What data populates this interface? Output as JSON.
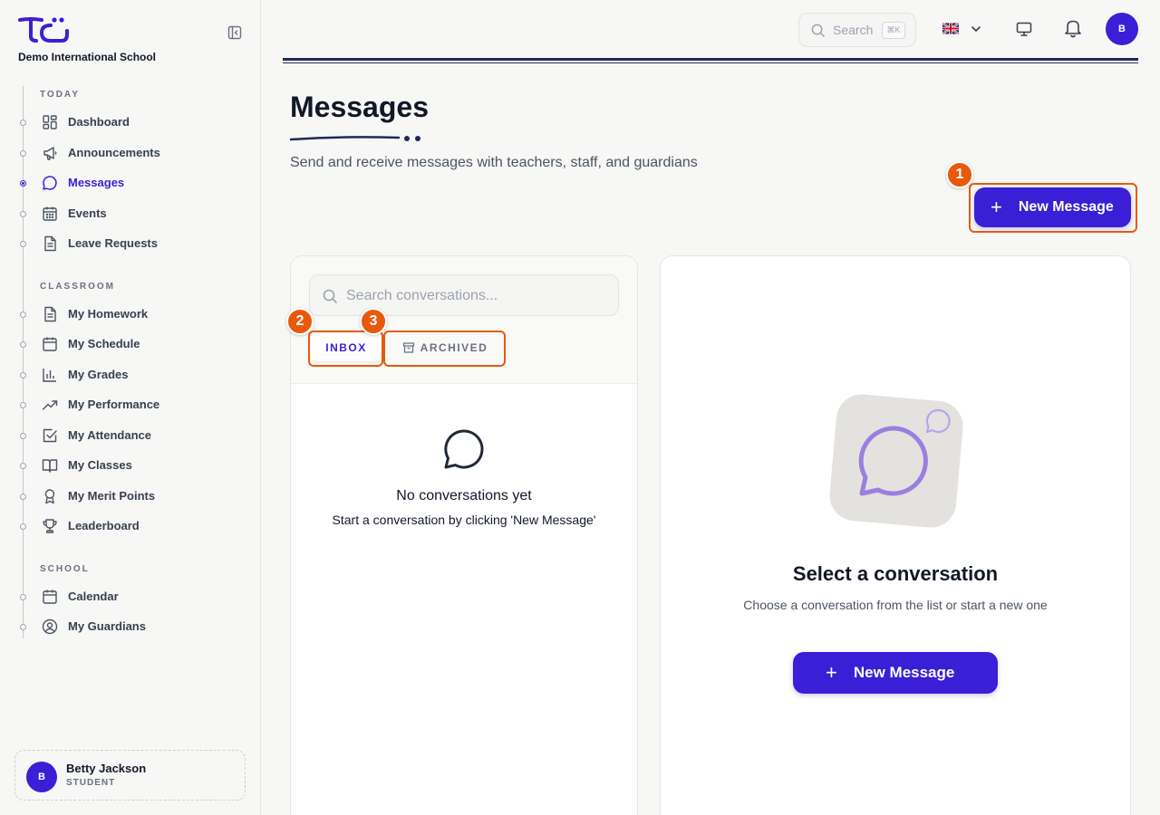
{
  "app": {
    "school_name": "Demo International School"
  },
  "sidebar": {
    "sections": [
      {
        "title": "TODAY",
        "items": [
          {
            "label": "Dashboard",
            "icon": "dashboard-icon"
          },
          {
            "label": "Announcements",
            "icon": "megaphone-icon"
          },
          {
            "label": "Messages",
            "icon": "chat-bubble-icon",
            "active": true
          },
          {
            "label": "Events",
            "icon": "calendar-grid-icon"
          },
          {
            "label": "Leave Requests",
            "icon": "document-icon"
          }
        ]
      },
      {
        "title": "CLASSROOM",
        "items": [
          {
            "label": "My Homework",
            "icon": "document-icon"
          },
          {
            "label": "My Schedule",
            "icon": "calendar-icon"
          },
          {
            "label": "My Grades",
            "icon": "bar-chart-icon"
          },
          {
            "label": "My Performance",
            "icon": "trending-up-icon"
          },
          {
            "label": "My Attendance",
            "icon": "checkbox-icon"
          },
          {
            "label": "My Classes",
            "icon": "book-icon"
          },
          {
            "label": "My Merit Points",
            "icon": "award-icon"
          },
          {
            "label": "Leaderboard",
            "icon": "trophy-icon"
          }
        ]
      },
      {
        "title": "SCHOOL",
        "items": [
          {
            "label": "Calendar",
            "icon": "calendar-icon"
          },
          {
            "label": "My Guardians",
            "icon": "user-circle-icon"
          }
        ]
      }
    ],
    "user": {
      "initial": "B",
      "name": "Betty Jackson",
      "role": "STUDENT"
    }
  },
  "topbar": {
    "search_label": "Search",
    "search_shortcut": "⌘K",
    "language_flag": "uk-flag-icon",
    "avatar_initial": "B"
  },
  "header": {
    "title": "Messages",
    "subtitle": "Send and receive messages with teachers, staff, and guardians",
    "new_message_label": "New Message"
  },
  "conversation_list": {
    "search_placeholder": "Search conversations...",
    "tabs": [
      {
        "label": "INBOX",
        "active": true
      },
      {
        "label": "ARCHIVED",
        "active": false
      }
    ],
    "empty_title": "No conversations yet",
    "empty_subtitle": "Start a conversation by clicking 'New Message'"
  },
  "detail": {
    "title": "Select a conversation",
    "subtitle": "Choose a conversation from the list or start a new one",
    "new_message_label": "New Message"
  },
  "annotations": [
    "1",
    "2",
    "3"
  ],
  "colors": {
    "brand": "#3b1fd6",
    "annotation": "#e8590c",
    "navy_rule": "#1e2a5a"
  }
}
